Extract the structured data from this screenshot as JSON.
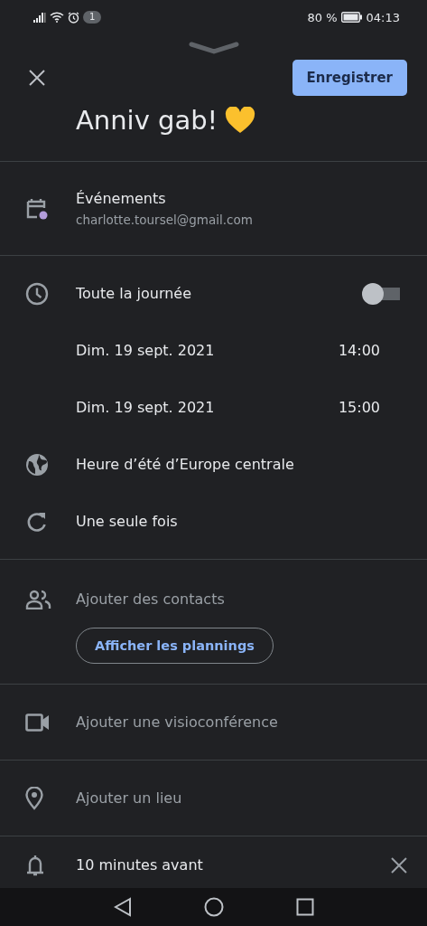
{
  "status_bar": {
    "notification_count": "1",
    "battery": "80 %",
    "time": "04:13"
  },
  "header": {
    "save_button": "Enregistrer",
    "title": "Anniv gab!"
  },
  "calendar": {
    "name": "Événements",
    "account": "charlotte.toursel@gmail.com"
  },
  "all_day": {
    "label": "Toute la journée",
    "on": false
  },
  "dates": [
    {
      "date": "Dim. 19 sept. 2021",
      "time": "14:00"
    },
    {
      "date": "Dim. 19 sept. 2021",
      "time": "15:00"
    }
  ],
  "timezone": "Heure d’été d’Europe centrale",
  "recurrence": "Une seule fois",
  "guests": {
    "placeholder": "Ajouter des contacts",
    "button": "Afficher les plannings"
  },
  "options": [
    {
      "kind": "video",
      "label": "Ajouter une visioconférence"
    },
    {
      "kind": "location",
      "label": "Ajouter un lieu"
    }
  ],
  "reminder": {
    "label": "10 minutes avant"
  }
}
